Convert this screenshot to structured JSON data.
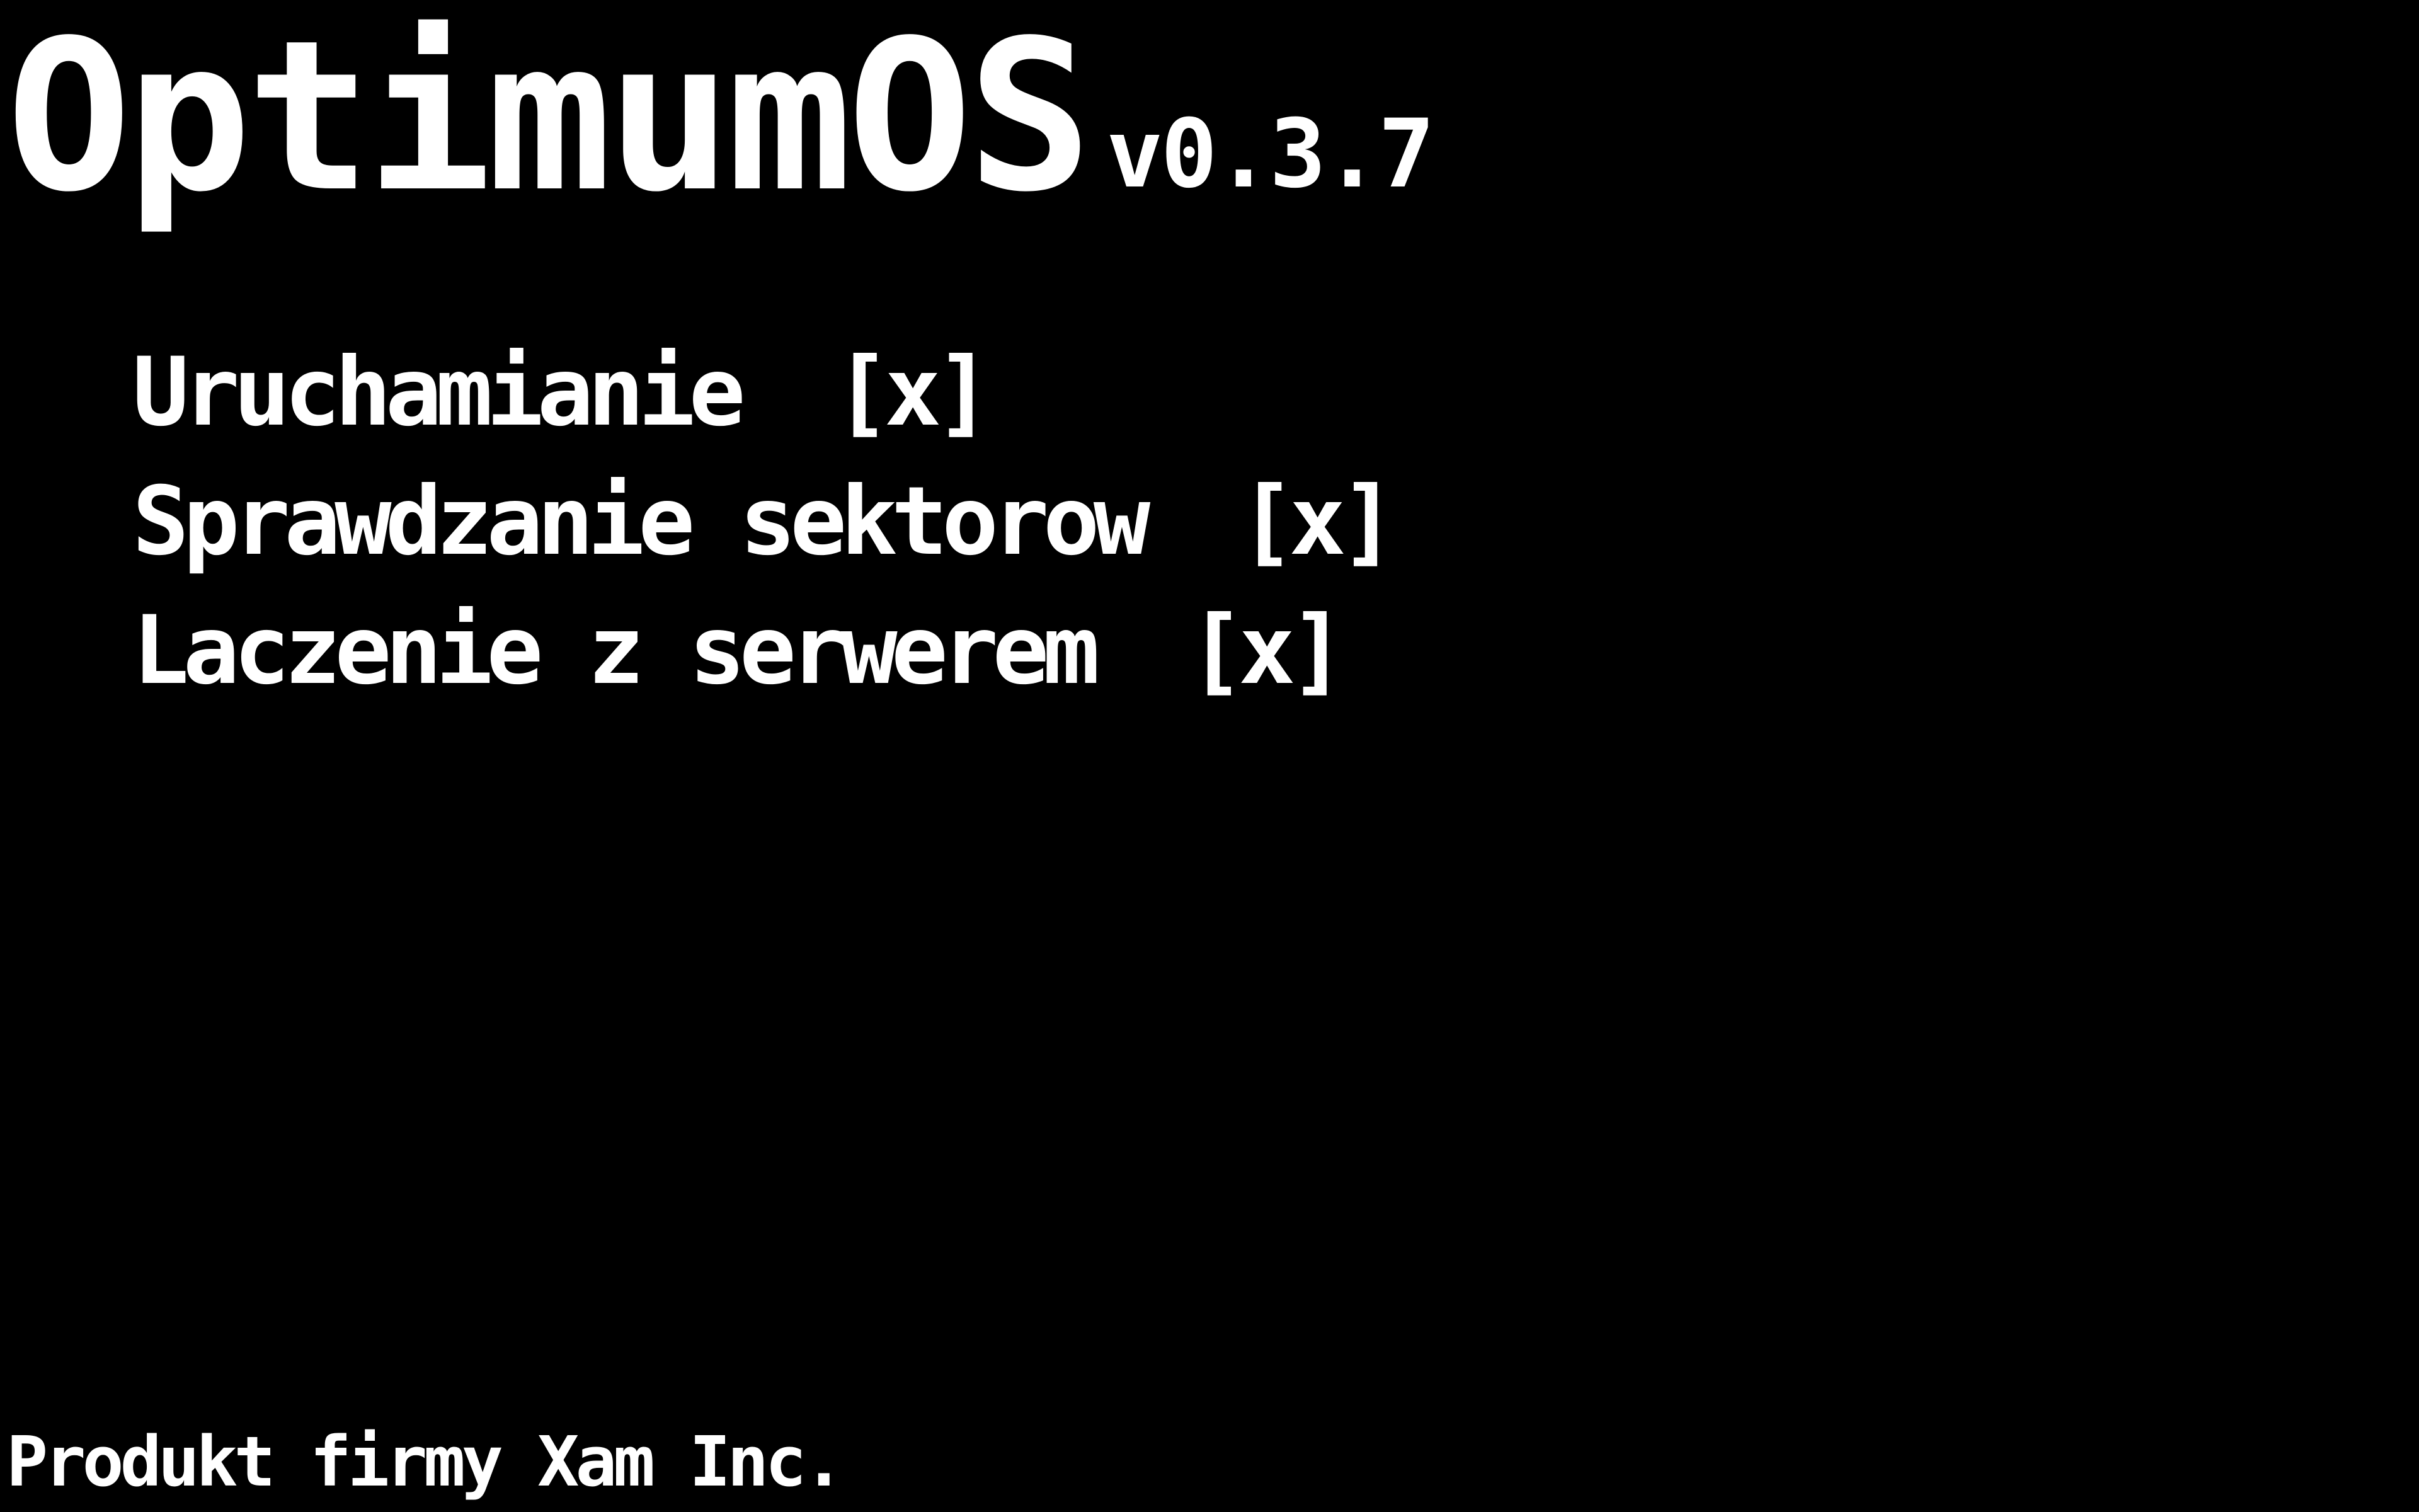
{
  "header": {
    "os_name": "OptimumOS",
    "version": "v0.3.7"
  },
  "boot_steps": [
    {
      "label": "Uruchamianie",
      "status": "[x]"
    },
    {
      "label": "Sprawdzanie sektorow",
      "status": "[x]"
    },
    {
      "label": "Laczenie z serwerem",
      "status": "[x]"
    }
  ],
  "footer": {
    "text": "Produkt firmy Xam Inc."
  },
  "colors": {
    "background": "#000000",
    "text": "#ffffff"
  }
}
